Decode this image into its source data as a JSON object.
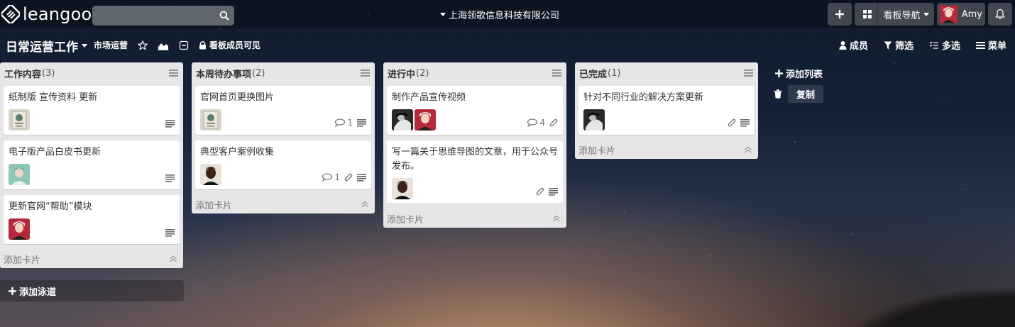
{
  "app": {
    "logo_text": "leangoo",
    "search_placeholder": "",
    "company": "上海领歌信息科技有限公司",
    "nav_label": "看板导航",
    "user_name": "Amy"
  },
  "board": {
    "title": "日常运营工作",
    "tag": "市场运营",
    "visibility": "看板成员可见",
    "actions": {
      "members": "成员",
      "filter": "筛选",
      "multiselect": "多选",
      "menu": "菜单"
    }
  },
  "lists": [
    {
      "title": "工作内容",
      "count": "(3)",
      "add_card": "添加卡片",
      "cards": [
        {
          "title": "纸制版 宣传资料 更新",
          "avatars": [
            "book"
          ],
          "comments": "",
          "attachment": false,
          "description": true
        },
        {
          "title": "电子版产品白皮书更新",
          "avatars": [
            "teal"
          ],
          "comments": "",
          "attachment": false,
          "description": true
        },
        {
          "title": "更新官网“帮助”模块",
          "avatars": [
            "red"
          ],
          "comments": "",
          "attachment": false,
          "description": true
        }
      ]
    },
    {
      "title": "本周待办事项",
      "count": "(2)",
      "add_card": "添加卡片",
      "cards": [
        {
          "title": "官网首页更换图片",
          "avatars": [
            "book"
          ],
          "comments": "1",
          "attachment": false,
          "description": true
        },
        {
          "title": "典型客户案例收集",
          "avatars": [
            "dark"
          ],
          "comments": "1",
          "attachment": true,
          "description": true
        }
      ]
    },
    {
      "title": "进行中",
      "count": "(2)",
      "add_card": "添加卡片",
      "cards": [
        {
          "title": "制作产品宣传视频",
          "avatars": [
            "bw",
            "red"
          ],
          "comments": "4",
          "attachment": true,
          "description": false
        },
        {
          "title": "写一篇关于思维导图的文章，用于公众号发布。",
          "avatars": [
            "dark"
          ],
          "comments": "",
          "attachment": true,
          "description": true
        }
      ]
    },
    {
      "title": "已完成",
      "count": "(1)",
      "add_card": "添加卡片",
      "cards": [
        {
          "title": "针对不同行业的解决方案更新",
          "avatars": [
            "bw"
          ],
          "comments": "",
          "attachment": true,
          "description": true
        }
      ]
    }
  ],
  "add_lane": "添加泳道",
  "add_list": "添加列表",
  "copy": "复制",
  "colors": {
    "list_bg": "#e6e6e6",
    "card_bg": "#ffffff",
    "text": "#333333"
  }
}
